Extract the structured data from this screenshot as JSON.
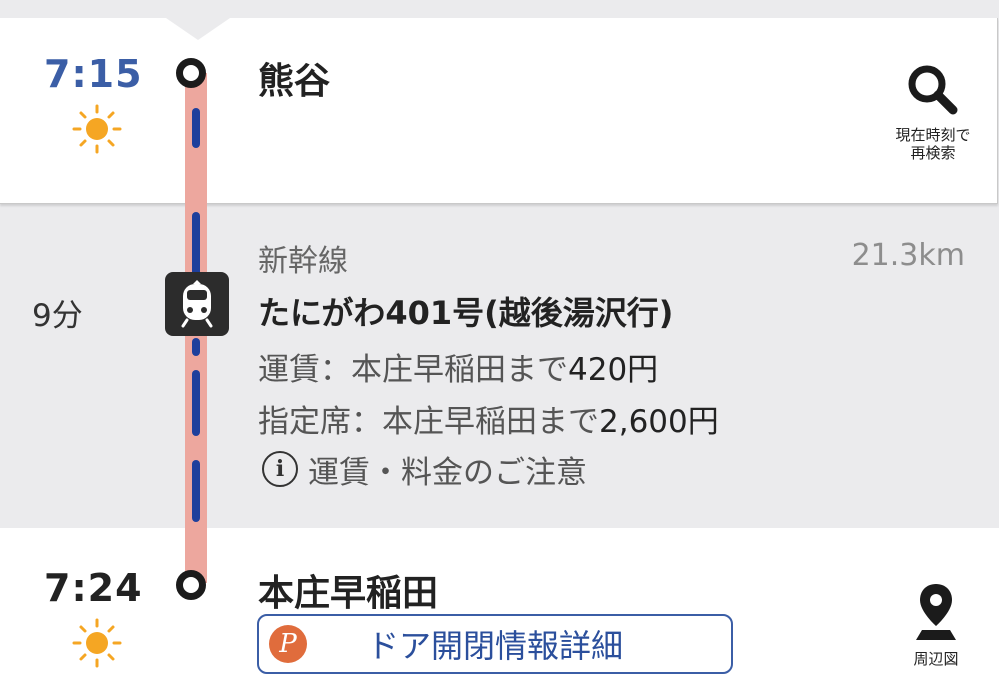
{
  "departure": {
    "time": "7:15",
    "station": "熊谷",
    "weather_icon": "sun-icon",
    "search_label_line1": "現在時刻で",
    "search_label_line2": "再検索"
  },
  "segment": {
    "duration": "9分",
    "line": "新幹線",
    "distance": "21.3km",
    "train": "たにがわ401号(越後湯沢行)",
    "fare_prefix": "運賃：本庄早稲田まで",
    "fare_value": "420円",
    "reserved_prefix": "指定席：本庄早稲田まで",
    "reserved_value": "2,600円",
    "notice": "運賃・料金のご注意"
  },
  "arrival": {
    "time": "7:24",
    "station": "本庄早稲田",
    "weather_icon": "sun-icon",
    "door_info": "ドア開閉情報詳細",
    "map_label": "周辺図"
  },
  "colors": {
    "time_blue": "#3b5ea6",
    "track": "#eda79e",
    "track_dash": "#1e3f9c",
    "sun": "#f5a623",
    "p_badge": "#e06c3c"
  }
}
